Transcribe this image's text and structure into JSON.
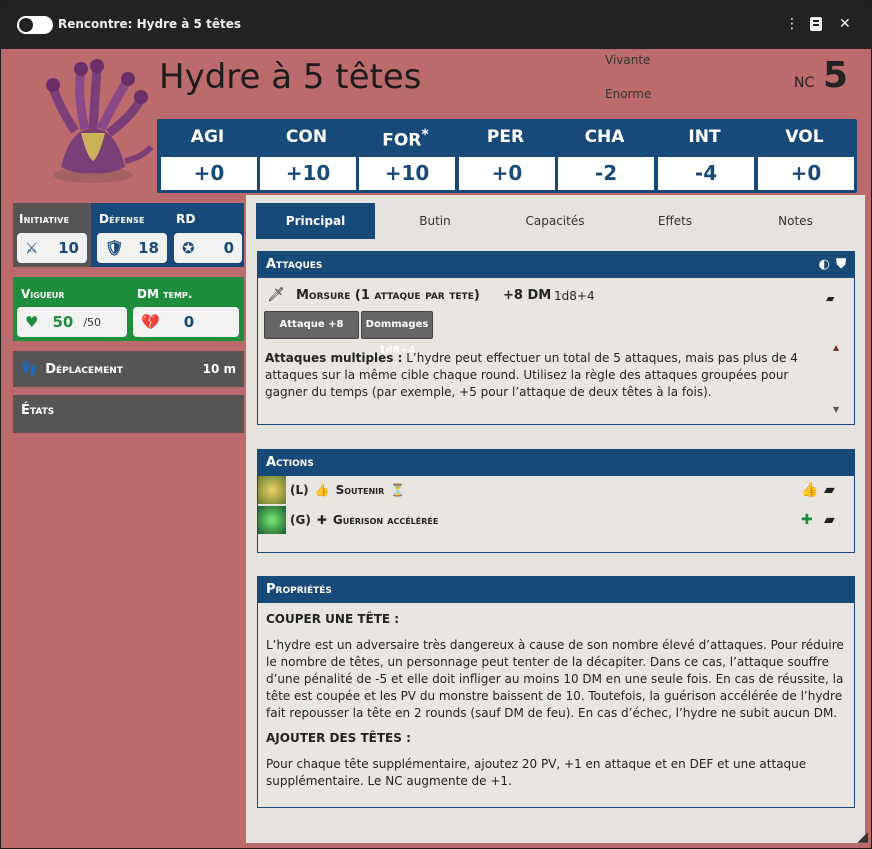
{
  "window": {
    "title": "Rencontre: Hydre à 5 têtes"
  },
  "header": {
    "name": "Hydre à 5 têtes",
    "status": "Vivante",
    "size": "Enorme",
    "nc_label": "NC",
    "nc_value": "5"
  },
  "stats": [
    {
      "label": "AGI",
      "value": "+0"
    },
    {
      "label": "CON",
      "value": "+10"
    },
    {
      "label": "FOR",
      "value": "+10",
      "marked": "*"
    },
    {
      "label": "PER",
      "value": "+0"
    },
    {
      "label": "CHA",
      "value": "-2"
    },
    {
      "label": "INT",
      "value": "-4"
    },
    {
      "label": "VOL",
      "value": "+0"
    }
  ],
  "combat": {
    "initiative_label": "Initiative",
    "initiative": "10",
    "defense_label": "Défense",
    "defense": "18",
    "rd_label": "RD",
    "rd": "0"
  },
  "vitals": {
    "vigueur_label": "Vigueur",
    "vigueur": "50",
    "vigueur_max": "/50",
    "dmtemp_label": "DM temp.",
    "dmtemp": "0"
  },
  "deplacement": {
    "label": "Déplacement",
    "value": "10 m"
  },
  "etats": {
    "label": "États"
  },
  "tabs": [
    "Principal",
    "Butin",
    "Capacités",
    "Effets",
    "Notes"
  ],
  "attaques": {
    "header": "Attaques",
    "name": "Morsure (1 attaque par tete)",
    "roll": "+8 DM",
    "dice": "1d8+4",
    "btn_attack": "Attaque +8",
    "btn_damage": "Dommages 1d8+4",
    "desc_bold": "Attaques multiples :",
    "desc": "L’hydre peut effectuer un total de 5 attaques, mais pas plus de 4 attaques sur la même cible chaque round. Utilisez la règle des attaques groupées pour gagner du temps (par exemple, +5 pour l’attaque de deux têtes à la fois)."
  },
  "actions": {
    "header": "Actions",
    "items": [
      {
        "type": "(L)",
        "name": "Soutenir",
        "icon": "thumbs-up-icon"
      },
      {
        "type": "(G)",
        "name": "Guérison accélérée",
        "icon": "heal-hand-icon"
      }
    ]
  },
  "proprietes": {
    "header": "Propriétés",
    "h1": "COUPER UNE TÊTE :",
    "p1": "L’hydre est un adversaire très dangereux à cause de son nombre élevé d’attaques. Pour réduire le nombre de têtes, un personnage peut tenter de la décapiter. Dans ce cas, l’attaque souffre d’une pénalité de -5 et elle doit infliger au moins 10 DM en une seule fois. En cas de réussite, la tête est coupée et les PV du monstre baissent de 10. Toutefois, la guérison accélérée de l’hydre fait repousser la tête en 2 rounds (sauf DM de feu). En cas d’échec, l’hydre ne subit aucun DM.",
    "h2": "AJOUTER DES TÊTES :",
    "p2": "Pour chaque tête supplémentaire, ajoutez 20 PV, +1 en attaque et en DEF et une attaque supplémentaire. Le NC augmente de +1."
  },
  "colors": {
    "blue": "#174a78",
    "green": "#1f8e3c",
    "red_bg": "#bb6b6b"
  }
}
